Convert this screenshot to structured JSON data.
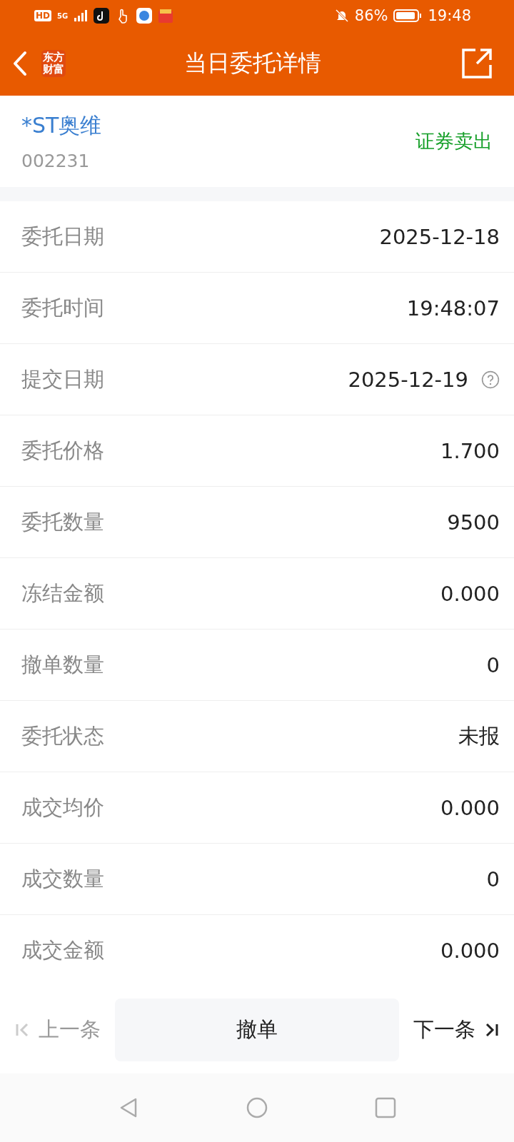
{
  "status_bar": {
    "battery": "86%",
    "time": "19:48",
    "network": "5G",
    "hd": "HD"
  },
  "header": {
    "title": "当日委托详情",
    "logo_lines": [
      "东方",
      "财富"
    ]
  },
  "stock": {
    "name": "*ST奥维",
    "code": "002231",
    "side": "证券卖出"
  },
  "rows": [
    {
      "label": "委托日期",
      "value": "2025-12-18",
      "help": false
    },
    {
      "label": "委托时间",
      "value": "19:48:07",
      "help": false
    },
    {
      "label": "提交日期",
      "value": "2025-12-19",
      "help": true
    },
    {
      "label": "委托价格",
      "value": "1.700",
      "help": false
    },
    {
      "label": "委托数量",
      "value": "9500",
      "help": false
    },
    {
      "label": "冻结金额",
      "value": "0.000",
      "help": false
    },
    {
      "label": "撤单数量",
      "value": "0",
      "help": false
    },
    {
      "label": "委托状态",
      "value": "未报",
      "help": false
    },
    {
      "label": "成交均价",
      "value": "0.000",
      "help": false
    },
    {
      "label": "成交数量",
      "value": "0",
      "help": false
    },
    {
      "label": "成交金额",
      "value": "0.000",
      "help": false
    }
  ],
  "footer": {
    "prev": {
      "label": "上一条",
      "disabled": true
    },
    "cancel": "撤单",
    "next": {
      "label": "下一条",
      "disabled": false
    }
  }
}
